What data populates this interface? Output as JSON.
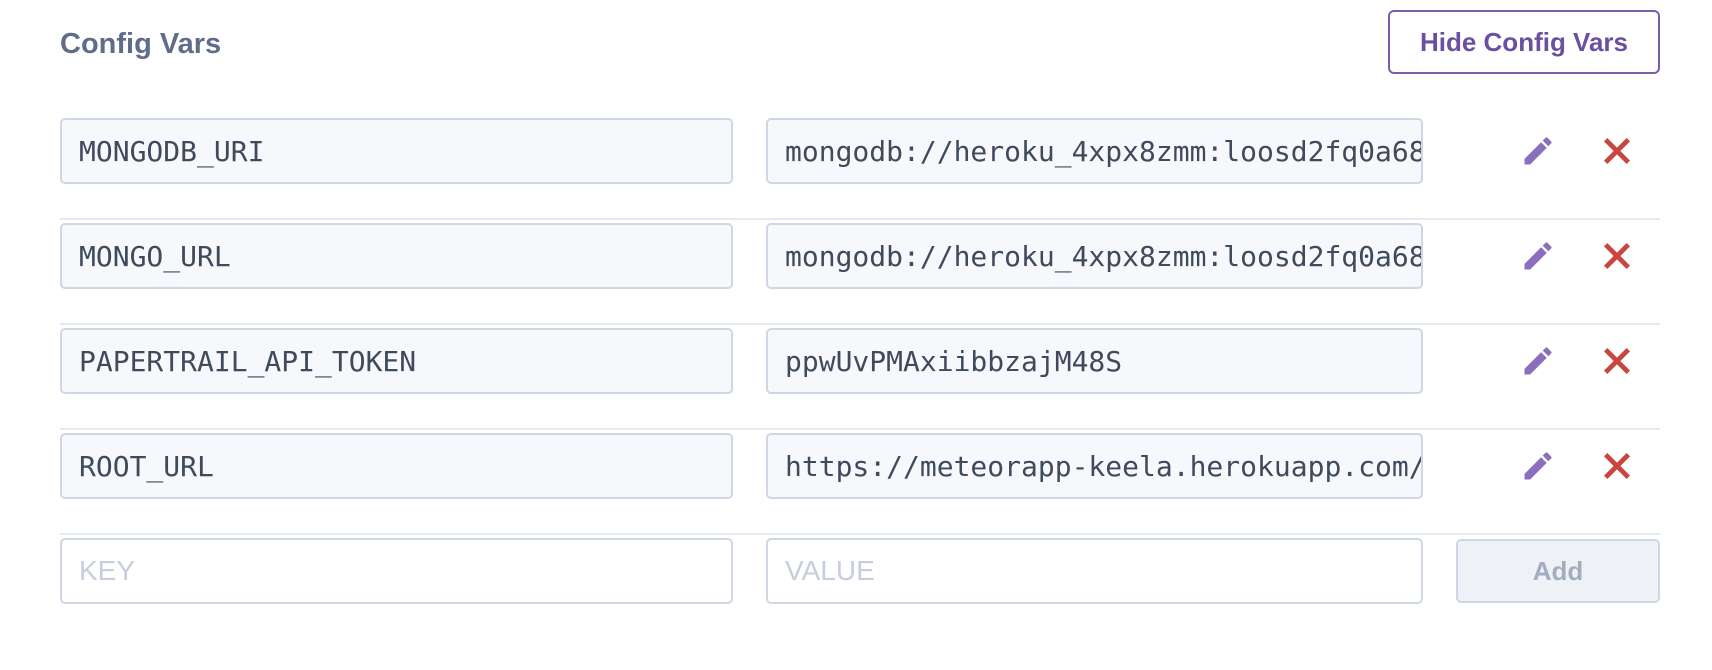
{
  "section": {
    "title": "Config Vars",
    "hide_button_label": "Hide Config Vars"
  },
  "config_vars": [
    {
      "key": "MONGODB_URI",
      "value": "mongodb://heroku_4xpx8zmm:loosd2fq0a68"
    },
    {
      "key": "MONGO_URL",
      "value": "mongodb://heroku_4xpx8zmm:loosd2fq0a68"
    },
    {
      "key": "PAPERTRAIL_API_TOKEN",
      "value": "ppwUvPMAxiibbzajM48S"
    },
    {
      "key": "ROOT_URL",
      "value": "https://meteorapp-keela.herokuapp.com/"
    }
  ],
  "new_var": {
    "key_placeholder": "KEY",
    "value_placeholder": "VALUE",
    "add_button_label": "Add"
  },
  "icons": {
    "edit": "pencil-icon",
    "delete": "x-icon"
  },
  "colors": {
    "accent": "#7a5fa8",
    "delete": "#c9453f",
    "title": "#5f6d89"
  }
}
